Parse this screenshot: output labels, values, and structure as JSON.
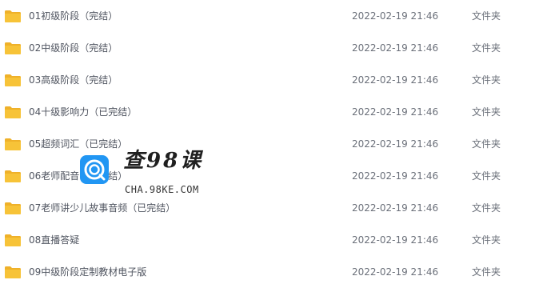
{
  "file_list": {
    "rows": [
      {
        "name": "01初级阶段（完结）",
        "date": "2022-02-19 21:46",
        "type": "文件夹",
        "icon": "folder-icon"
      },
      {
        "name": "02中级阶段（完结）",
        "date": "2022-02-19 21:46",
        "type": "文件夹",
        "icon": "folder-icon"
      },
      {
        "name": "03高级阶段（完结）",
        "date": "2022-02-19 21:46",
        "type": "文件夹",
        "icon": "folder-icon"
      },
      {
        "name": "04十级影响力（已完结）",
        "date": "2022-02-19 21:46",
        "type": "文件夹",
        "icon": "folder-icon"
      },
      {
        "name": "05超频词汇（已完结）",
        "date": "2022-02-19 21:46",
        "type": "文件夹",
        "icon": "folder-icon"
      },
      {
        "name": "06老师配音（已完结）",
        "date": "2022-02-19 21:46",
        "type": "文件夹",
        "icon": "folder-icon"
      },
      {
        "name": "07老师讲少儿故事音频（已完结）",
        "date": "2022-02-19 21:46",
        "type": "文件夹",
        "icon": "folder-icon"
      },
      {
        "name": "08直播答疑",
        "date": "2022-02-19 21:46",
        "type": "文件夹",
        "icon": "folder-icon"
      },
      {
        "name": "09中级阶段定制教材电子版",
        "date": "2022-02-19 21:46",
        "type": "文件夹",
        "icon": "folder-icon"
      }
    ]
  },
  "watermark": {
    "title": "查98课",
    "url": "CHA.98KE.COM"
  },
  "colors": {
    "folder": "#f7c338",
    "folder_tab": "#efb12a",
    "logo_blue": "#2196f3",
    "text": "#505560"
  }
}
